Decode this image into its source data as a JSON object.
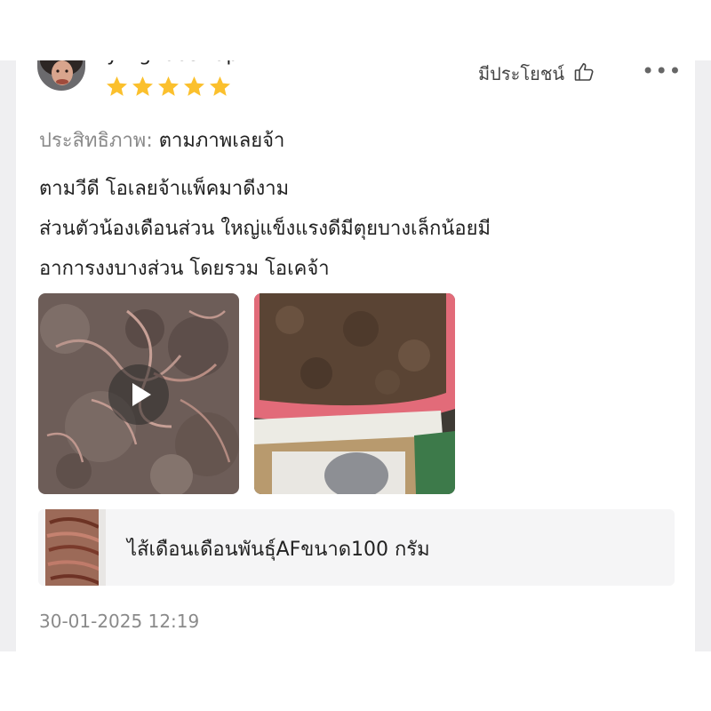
{
  "review": {
    "username": "yingzooshop",
    "rating": 5,
    "helpful_label": "มีประโยชน์",
    "performance_label": "ประสิทธิภาพ:",
    "performance_value": "ตามภาพเลยจ้า",
    "body_lines": [
      "ตามวีดี โอเลยจ้าแพ็คมาดีงาม",
      "ส่วนตัวน้องเดือนส่วน ใหญ่แข็งแรงดีมีตุยบางเล็กน้อยมี",
      "อาการงงบางส่วน โดยรวม โอเคจ้า"
    ],
    "product_name": "ไส้เดือนเดือนพันธุ์AFขนาด100 กรัม",
    "date": "30-01-2025 12:19"
  },
  "icons": {
    "star": "star-icon",
    "helpful": "thumbs-up-icon",
    "more": "more-icon",
    "play": "play-icon"
  },
  "colors": {
    "star": "#fbc02d",
    "muted_text": "#8a8a8a",
    "card_bg": "#ffffff",
    "page_bg": "#efeff1"
  }
}
